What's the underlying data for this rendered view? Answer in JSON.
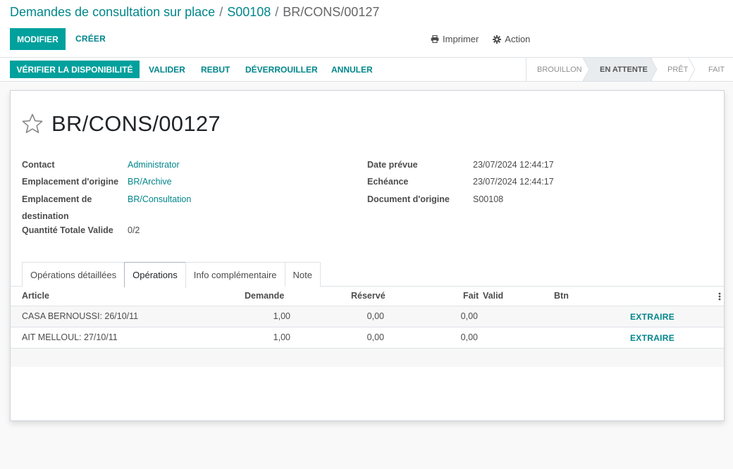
{
  "breadcrumb": {
    "root": "Demandes de consultation sur place",
    "parent": "S00108",
    "current": "BR/CONS/00127",
    "separator": "/"
  },
  "toolbar": {
    "edit_label": "MODIFIER",
    "create_label": "CRÉER",
    "print_label": "Imprimer",
    "action_label": "Action"
  },
  "header": {
    "buttons": {
      "check": "VÉRIFIER LA DISPONIBILITÉ",
      "validate": "VALIDER",
      "scrap": "REBUT",
      "unlock": "DÉVERROUILLER",
      "cancel": "ANNULER"
    },
    "steps": [
      "BROUILLON",
      "EN ATTENTE",
      "PRÊT",
      "FAIT"
    ],
    "active_step": "EN ATTENTE"
  },
  "record": {
    "title": "BR/CONS/00127"
  },
  "fields": {
    "contact_label": "Contact",
    "contact_value": "Administrator",
    "origin_label": "Emplacement d'origine",
    "origin_value": "BR/Archive",
    "dest_label_1": "Emplacement de",
    "dest_label_2": "destination",
    "dest_value": "BR/Consultation",
    "qty_label": "Quantité Totale Valide",
    "qty_value": "0/2",
    "date_label": "Date prévue",
    "date_value": "23/07/2024 12:44:17",
    "deadline_label": "Echéance",
    "deadline_value": "23/07/2024 12:44:17",
    "source_label": "Document d'origine",
    "source_value": "S00108"
  },
  "tabs": [
    "Opérations détaillées",
    "Opérations",
    "Info complémentaire",
    "Note"
  ],
  "active_tab": "Opérations",
  "table": {
    "headers": {
      "article": "Article",
      "demand": "Demande",
      "reserved": "Réservé",
      "done": "Fait",
      "valid": "Valid",
      "btn": "Btn"
    },
    "rows": [
      {
        "article": "CASA BERNOUSSI: 26/10/11",
        "demand": "1,00",
        "reserved": "0,00",
        "done": "0,00",
        "action": "EXTRAIRE"
      },
      {
        "article": "AIT MELLOUL: 27/10/11",
        "demand": "1,00",
        "reserved": "0,00",
        "done": "0,00",
        "action": "EXTRAIRE"
      }
    ]
  },
  "colors": {
    "primary": "#00a09d",
    "link": "#00868b"
  }
}
